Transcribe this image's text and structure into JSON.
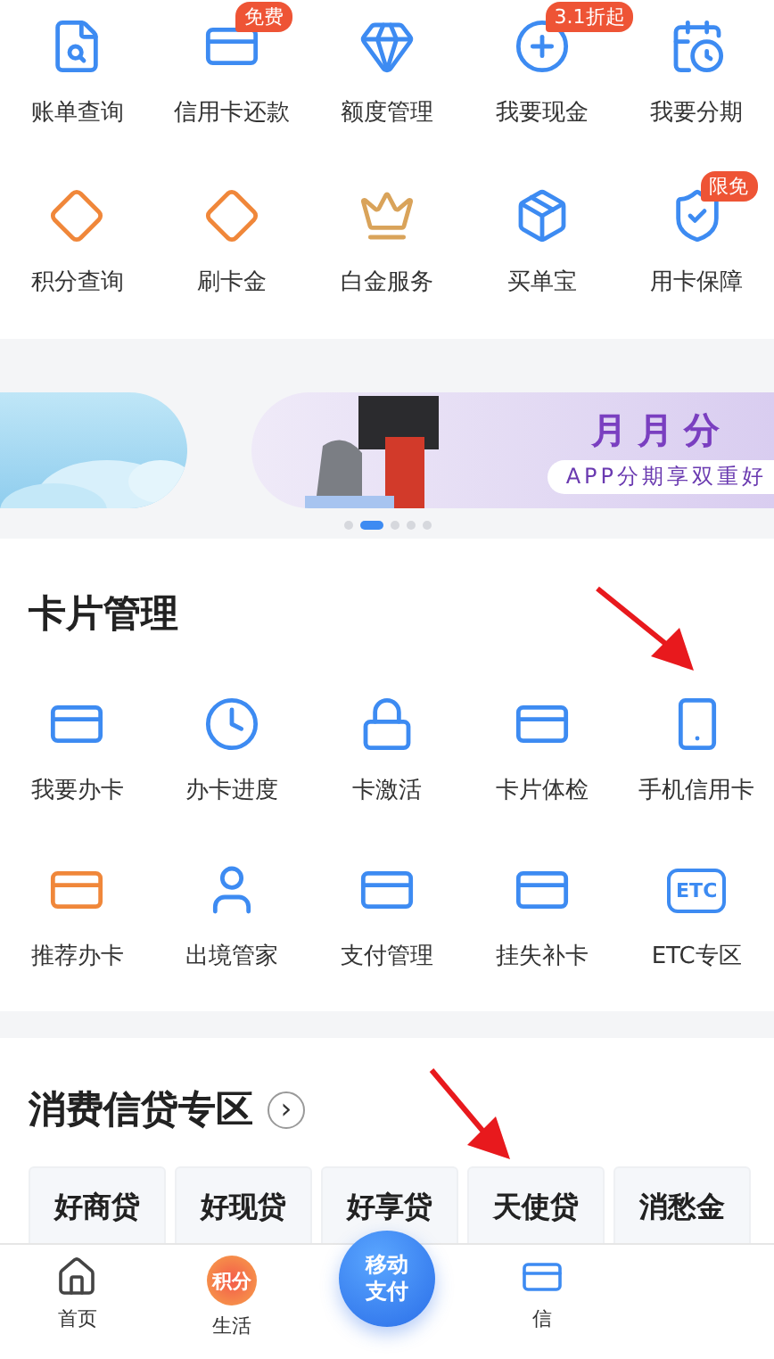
{
  "top_menu": [
    {
      "label": "账单查询"
    },
    {
      "label": "信用卡还款",
      "badge": "免费"
    },
    {
      "label": "额度管理"
    },
    {
      "label": "我要现金",
      "badge": "3.1折起"
    },
    {
      "label": "我要分期"
    },
    {
      "label": "积分查询"
    },
    {
      "label": "刷卡金"
    },
    {
      "label": "白金服务"
    },
    {
      "label": "买单宝"
    },
    {
      "label": "用卡保障",
      "badge": "限免"
    }
  ],
  "banner": {
    "title": "月月分",
    "subtitle": "APP分期享双重好",
    "dots": [
      {
        "selected": false
      },
      {
        "selected": true
      },
      {
        "selected": false
      },
      {
        "selected": false
      },
      {
        "selected": false
      }
    ]
  },
  "card_section": {
    "title": "卡片管理",
    "items": [
      {
        "label": "我要办卡"
      },
      {
        "label": "办卡进度"
      },
      {
        "label": "卡激活"
      },
      {
        "label": "卡片体检"
      },
      {
        "label": "手机信用卡"
      },
      {
        "label": "推荐办卡"
      },
      {
        "label": "出境管家"
      },
      {
        "label": "支付管理"
      },
      {
        "label": "挂失补卡"
      },
      {
        "label": "ETC专区",
        "icon_text": "ETC"
      }
    ]
  },
  "loan_section": {
    "title": "消费信贷专区",
    "more": "›",
    "products": [
      "好商贷",
      "好现贷",
      "好享贷",
      "天使贷",
      "消愁金"
    ]
  },
  "tab_bar": {
    "items": [
      {
        "label": "首页"
      },
      {
        "label": "生活",
        "icon_text": "积分"
      },
      {
        "label": "信"
      }
    ],
    "center": "移动支付"
  },
  "annotations": [
    {
      "kind": "arrow"
    },
    {
      "kind": "arrow"
    }
  ]
}
